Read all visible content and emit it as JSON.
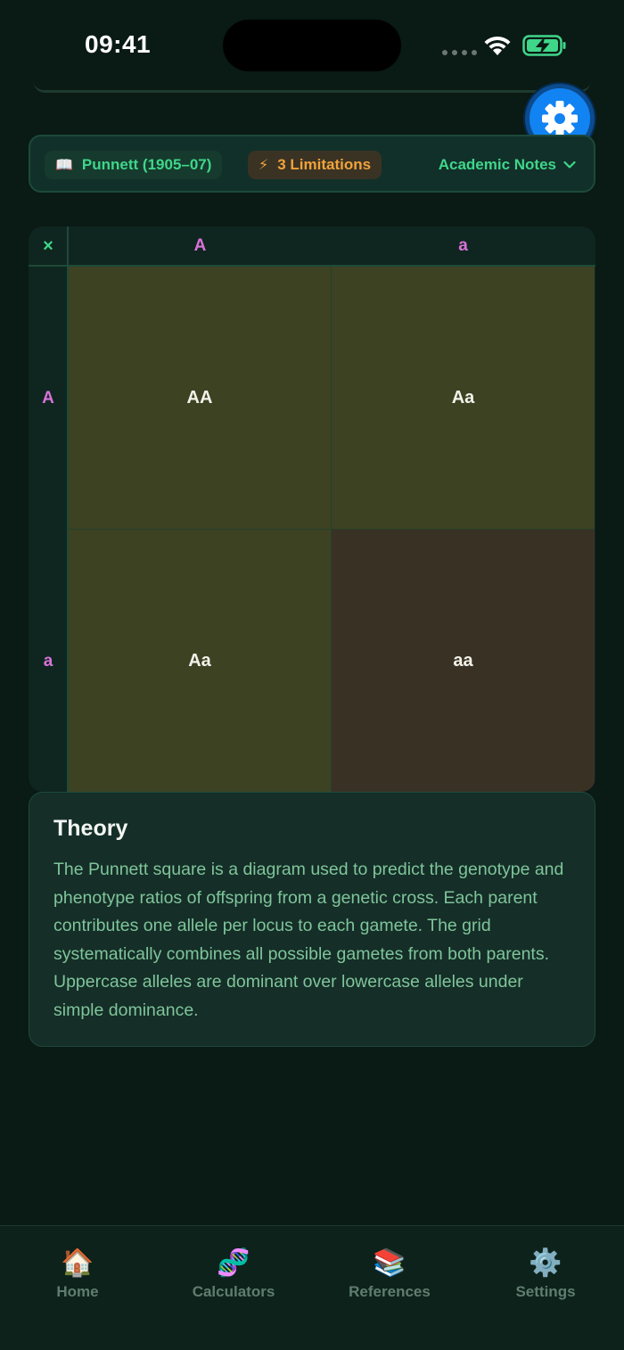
{
  "status_bar": {
    "time": "09:41"
  },
  "toolbar": {
    "settings_icon": "gear-icon"
  },
  "chips": {
    "reference_icon": "📖",
    "reference_label": "Punnett (1905–07)",
    "limitations_icon": "⚡",
    "limitations_label": "3 Limitations",
    "notes_label": "Academic Notes"
  },
  "punnett": {
    "corner_symbol": "×",
    "columns": [
      "A",
      "a"
    ],
    "rows": [
      "A",
      "a"
    ],
    "cells": [
      [
        "AA",
        "Aa"
      ],
      [
        "Aa",
        "aa"
      ]
    ]
  },
  "theory": {
    "title": "Theory",
    "body": "The Punnett square is a diagram used to predict the genotype and phenotype ratios of offspring from a genetic cross. Each parent contributes one allele per locus to each gamete. The grid systematically combines all possible gametes from both parents. Uppercase alleles are dominant over lowercase alleles under simple dominance."
  },
  "tabs": [
    {
      "icon": "🏠",
      "label": "Home"
    },
    {
      "icon": "🧬",
      "label": "Calculators"
    },
    {
      "icon": "📚",
      "label": "References"
    },
    {
      "icon": "⚙️",
      "label": "Settings"
    }
  ],
  "colors": {
    "background": "#0a1a14",
    "accent_green": "#3fd68a",
    "allele_pink": "#d872d8",
    "warning_orange": "#f2a23a",
    "fab_blue": "#1283f2",
    "dominant_cell": "#3d4223",
    "recessive_cell": "#3a3125"
  }
}
